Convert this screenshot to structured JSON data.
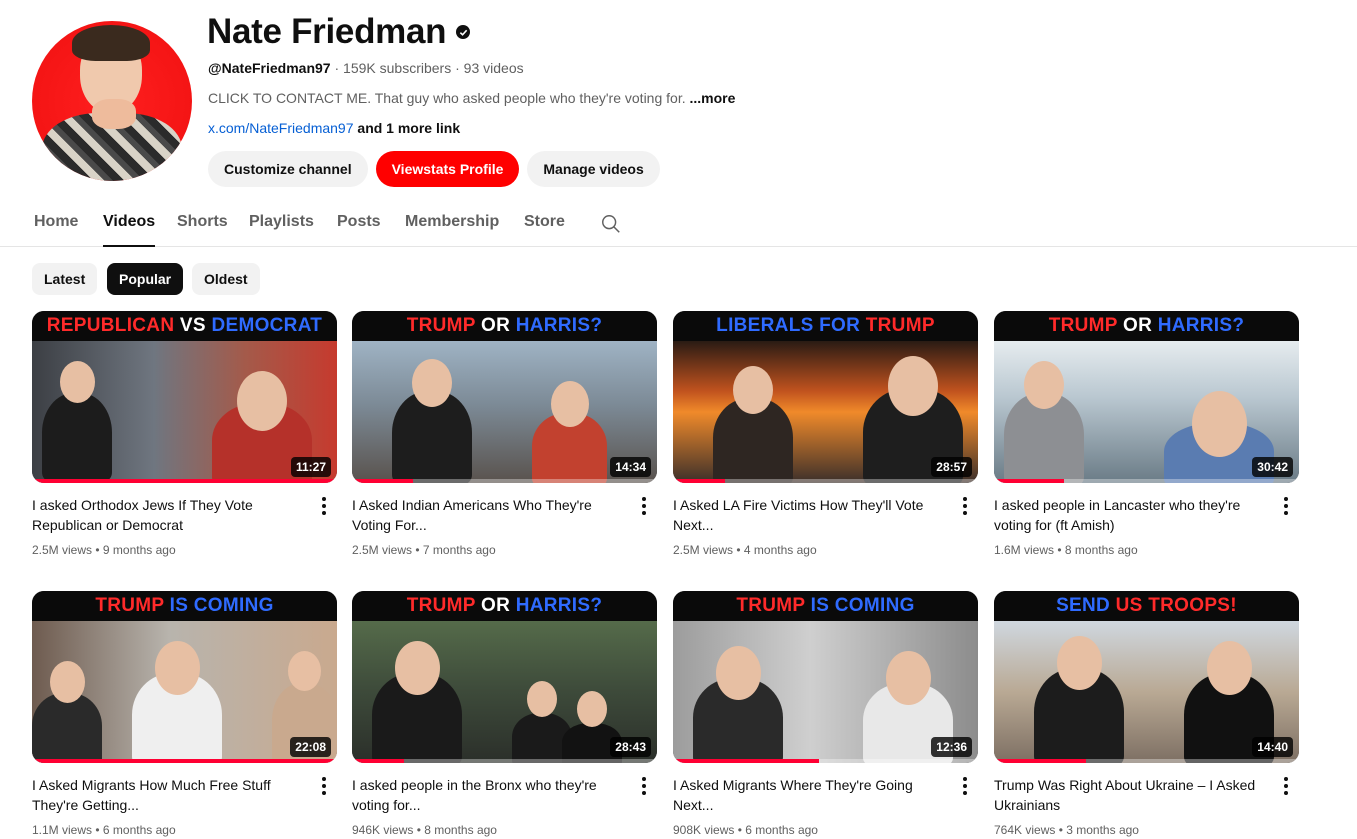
{
  "channel": {
    "name": "Nate Friedman",
    "handle": "@NateFriedman97",
    "subscribers": "159K subscribers",
    "videos_count": "93 videos",
    "description": "CLICK TO CONTACT ME. That guy who asked people who they're voting for.",
    "more_label": "...more",
    "link": "x.com/NateFriedman97",
    "more_links": "and 1 more link",
    "icons": {
      "verified": "verified-check-icon",
      "avatar": "avatar"
    }
  },
  "buttons": {
    "customize": "Customize channel",
    "viewstats": "Viewstats Profile",
    "manage": "Manage videos"
  },
  "tabs": [
    "Home",
    "Videos",
    "Shorts",
    "Playlists",
    "Posts",
    "Membership",
    "Store"
  ],
  "active_tab": "Videos",
  "chips": [
    "Latest",
    "Popular",
    "Oldest"
  ],
  "active_chip": "Popular",
  "colors": {
    "accent": "#ff0000",
    "link": "#065fd4",
    "progress": "#ff0033"
  },
  "videos": [
    {
      "banner": [
        {
          "t": "REPUBLICAN ",
          "c": "#ff2a2a"
        },
        {
          "t": "VS ",
          "c": "#ffffff"
        },
        {
          "t": "DEMOCRAT",
          "c": "#2f6bff"
        }
      ],
      "duration": "11:27",
      "title": "I asked Orthodox Jews If They Vote Republican or Democrat",
      "views": "2.5M views",
      "age": "9 months ago",
      "watched": 1.0
    },
    {
      "banner": [
        {
          "t": "TRUMP ",
          "c": "#ff2a2a"
        },
        {
          "t": "OR ",
          "c": "#ffffff"
        },
        {
          "t": "HARRIS?",
          "c": "#2f6bff"
        }
      ],
      "duration": "14:34",
      "title": "I Asked Indian Americans Who They're Voting For...",
      "views": "2.5M views",
      "age": "7 months ago",
      "watched": 0.2
    },
    {
      "banner": [
        {
          "t": "LIBERALS ",
          "c": "#2f6bff"
        },
        {
          "t": "FOR ",
          "c": "#2f6bff"
        },
        {
          "t": "TRUMP",
          "c": "#ff2a2a"
        }
      ],
      "duration": "28:57",
      "title": "I Asked LA Fire Victims How They'll Vote Next...",
      "views": "2.5M views",
      "age": "4 months ago",
      "watched": 0.17
    },
    {
      "banner": [
        {
          "t": "TRUMP ",
          "c": "#ff2a2a"
        },
        {
          "t": "OR ",
          "c": "#ffffff"
        },
        {
          "t": "HARRIS?",
          "c": "#2f6bff"
        }
      ],
      "duration": "30:42",
      "title": "I asked people in Lancaster who they're voting for (ft Amish)",
      "views": "1.6M views",
      "age": "8 months ago",
      "watched": 0.23
    },
    {
      "banner": [
        {
          "t": "TRUMP ",
          "c": "#ff2a2a"
        },
        {
          "t": "IS ",
          "c": "#2f6bff"
        },
        {
          "t": "COMING",
          "c": "#2f6bff"
        }
      ],
      "duration": "22:08",
      "title": "I Asked Migrants How Much Free Stuff They're Getting...",
      "views": "1.1M views",
      "age": "6 months ago",
      "watched": 1.0
    },
    {
      "banner": [
        {
          "t": "TRUMP ",
          "c": "#ff2a2a"
        },
        {
          "t": "OR ",
          "c": "#ffffff"
        },
        {
          "t": "HARRIS?",
          "c": "#2f6bff"
        }
      ],
      "duration": "28:43",
      "title": "I asked people in the Bronx who they're voting for...",
      "views": "946K views",
      "age": "8 months ago",
      "watched": 0.17
    },
    {
      "banner": [
        {
          "t": "TRUMP ",
          "c": "#ff2a2a"
        },
        {
          "t": "IS ",
          "c": "#2f6bff"
        },
        {
          "t": "COMING",
          "c": "#2f6bff"
        }
      ],
      "duration": "12:36",
      "title": "I Asked Migrants Where They're Going Next...",
      "views": "908K views",
      "age": "6 months ago",
      "watched": 0.48
    },
    {
      "banner": [
        {
          "t": "SEND ",
          "c": "#2f6bff"
        },
        {
          "t": "US ",
          "c": "#ff2a2a"
        },
        {
          "t": "TROOPS!",
          "c": "#ff2a2a"
        }
      ],
      "duration": "14:40",
      "title": "Trump Was Right About Ukraine – I Asked Ukrainians",
      "views": "764K views",
      "age": "3 months ago",
      "watched": 0.3
    }
  ]
}
